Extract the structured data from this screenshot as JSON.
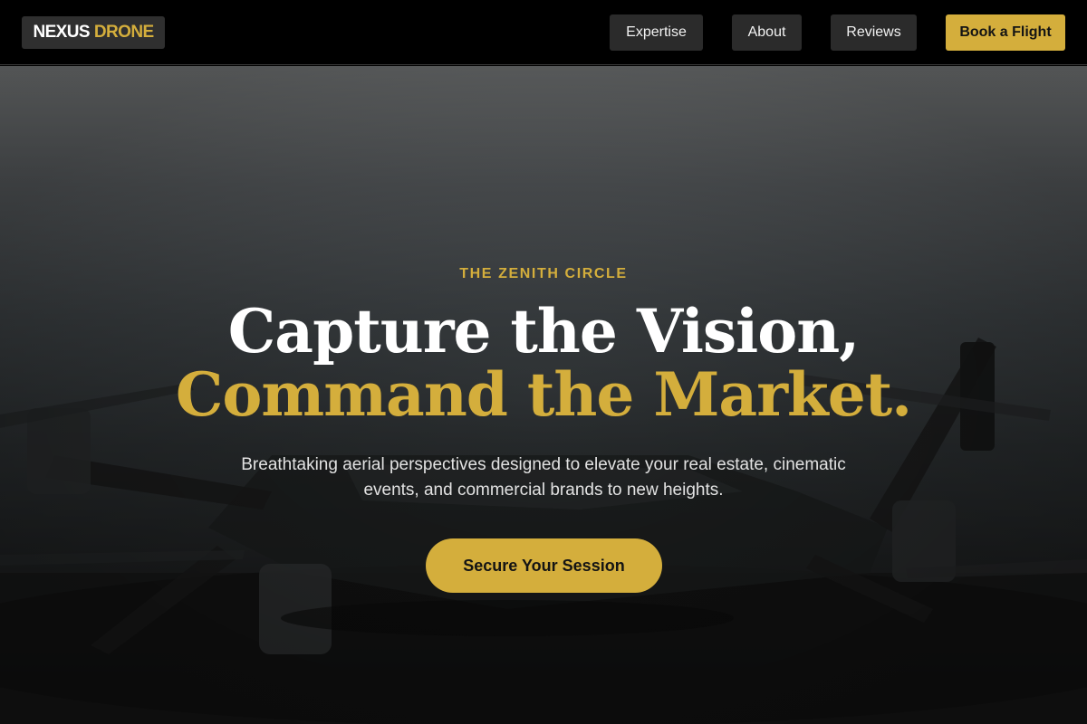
{
  "brand": {
    "name_primary": "NEXUS",
    "name_accent": "DRONE"
  },
  "nav": {
    "items": [
      {
        "label": "Expertise"
      },
      {
        "label": "About"
      },
      {
        "label": "Reviews"
      }
    ],
    "cta_label": "Book a Flight"
  },
  "hero": {
    "eyebrow": "THE ZENITH CIRCLE",
    "headline_line1": "Capture the Vision,",
    "headline_line2": "Command the Market.",
    "subtext": "Breathtaking aerial perspectives designed to elevate your real estate, cinematic events, and commercial brands to new heights.",
    "cta_label": "Secure Your Session"
  },
  "colors": {
    "accent": "#d4ae3c",
    "nav_background": "#000000",
    "nav_button": "#2b2b2b",
    "text_light": "#ffffff"
  }
}
